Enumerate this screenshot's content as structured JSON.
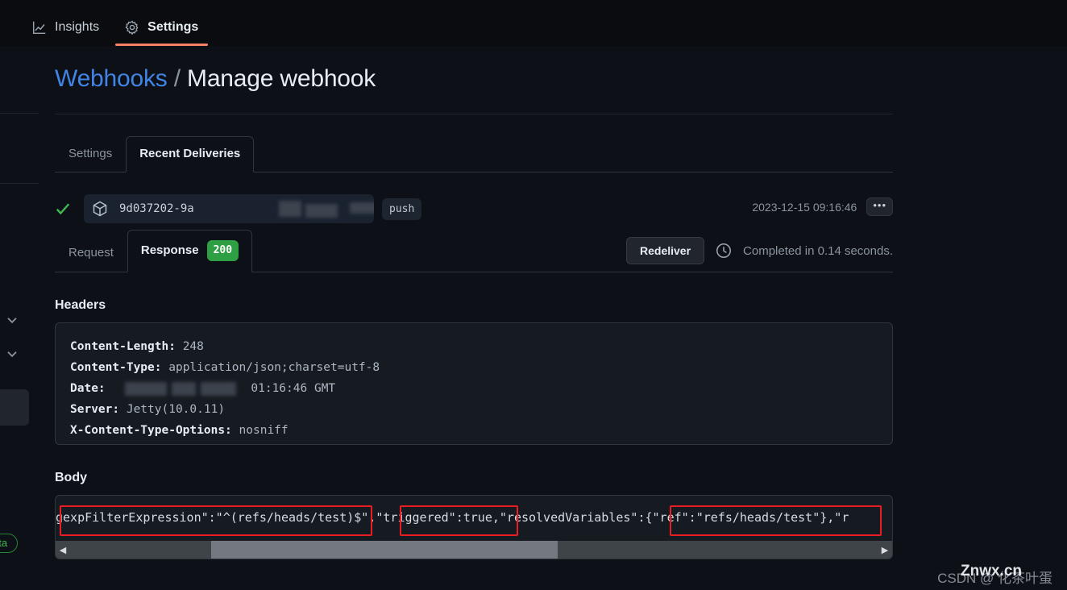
{
  "topnav": {
    "items": [
      {
        "label": "Insights",
        "icon": "graph-icon",
        "active": false
      },
      {
        "label": "Settings",
        "icon": "gear-icon",
        "active": true
      }
    ]
  },
  "page": {
    "breadcrumb_link": "Webhooks",
    "breadcrumb_separator": "/",
    "breadcrumb_current": "Manage webhook"
  },
  "tabs": {
    "settings": "Settings",
    "recent_deliveries": "Recent Deliveries"
  },
  "delivery": {
    "status_icon": "check-icon",
    "payload_icon": "package-icon",
    "guid": "9d037202-9a",
    "event_badge": "push",
    "timestamp": "2023-12-15 09:16:46",
    "kebab_label": "•••"
  },
  "subtabs": {
    "request": "Request",
    "response": "Response",
    "status_code": "200"
  },
  "actions": {
    "redeliver": "Redeliver",
    "clock_icon": "clock-icon",
    "completed": "Completed in 0.14 seconds."
  },
  "headers": {
    "title": "Headers",
    "lines": [
      {
        "key": "Content-Length:",
        "value": "248"
      },
      {
        "key": "Content-Type:",
        "value": "application/json;charset=utf-8"
      },
      {
        "key": "Date:",
        "value": "01:16:46 GMT",
        "redacted": true
      },
      {
        "key": "Server:",
        "value": "Jetty(10.0.11)"
      },
      {
        "key": "X-Content-Type-Options:",
        "value": "nosniff"
      }
    ]
  },
  "body": {
    "title": "Body",
    "code": "gexpFilterExpression\":\"^(refs/heads/test)$\",\"triggered\":true,\"resolvedVariables\":{\"ref\":\"refs/heads/test\"},\"r",
    "highlights": [
      {
        "label": "expFilterExpression\":\"^(refs/heads/test)$"
      },
      {
        "label": "\"triggered\":true"
      },
      {
        "label": "{\"ref\":\"refs/heads/test\"}"
      }
    ],
    "scrollbar": {
      "left_arrow": "◀",
      "right_arrow": "▶"
    }
  },
  "side": {
    "beta_badge": "eta"
  },
  "watermark": {
    "csdn": "CSDN @ 化茶叶蛋",
    "site": "Znwx.cn"
  },
  "colors": {
    "background": "#0d1117",
    "panel": "#161b22",
    "accent_orange": "#f78166",
    "link_blue": "#4184e4",
    "success_green": "#2ea043",
    "highlight_red": "#ec1c24"
  }
}
